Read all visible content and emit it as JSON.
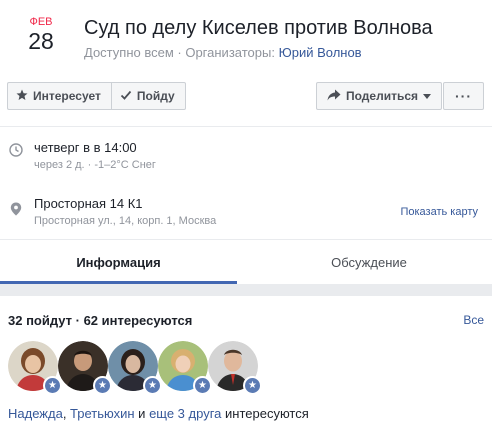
{
  "event": {
    "month": "ФЕВ",
    "day": "28",
    "title": "Суд по делу Киселев против Волнова",
    "privacy": "Доступно всем",
    "separator": " · ",
    "organizers_label": "Организаторы:",
    "organizer": "Юрий Волнов"
  },
  "actions": {
    "interested_label": "Интересует",
    "going_label": "Пойду",
    "share_label": "Поделиться",
    "more_label": "···"
  },
  "details": {
    "time_main": "четверг в в 14:00",
    "time_sub": "через 2 д. · -1–2°C Снег",
    "place_main": "Просторная 14 К1",
    "place_sub": "Просторная ул., 14, корп. 1, Москва",
    "map_link": "Показать карту"
  },
  "tabs": {
    "info": "Информация",
    "discussion": "Обсуждение"
  },
  "attendance": {
    "summary": "32 пойдут · 62 интересуются",
    "see_all": "Все",
    "friend1": "Надежда",
    "comma": ", ",
    "friend2": "Третьюхин",
    "and": " и ",
    "others": "еще 3 друга",
    "tail": " интересуются"
  },
  "colors": {
    "accent": "#4267b2",
    "link": "#365899",
    "month_red": "#f02849",
    "muted": "#90949c"
  },
  "icons": [
    "star-icon",
    "check-icon",
    "share-arrow-icon",
    "caret-down-icon",
    "more-dots-icon",
    "clock-icon",
    "pin-icon"
  ]
}
